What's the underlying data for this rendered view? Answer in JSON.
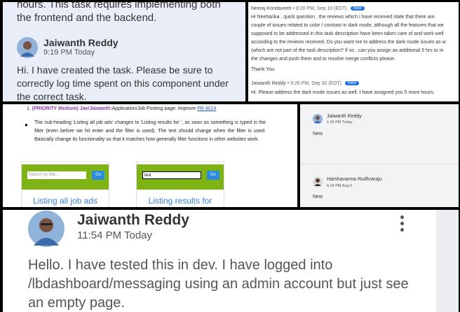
{
  "panel1": {
    "overflow_text": "hours. This task requires implementing both the frontend and the backend.",
    "author": "Jaiwanth Reddy",
    "time": "9:19 PM Today",
    "body": "Hi. I have created the task. Please be sure to correctly log time spent on this component under the correct task."
  },
  "panel2": {
    "comment1": {
      "author": "Neeraj Kondaveeti",
      "time": "• 8:20 PM, Sep 10 (EDT)",
      "badge": "New",
      "lines": [
        "Hi Neeharika , quick question , the reviews which i have received state that there are",
        "couple of issues related to color / contrast in dark mode, although all the features that we",
        "supposed to be addressed in this task description have been taken care of and work well",
        "according to the reviews received. Do you want me to address the dark mode issues as w",
        "(which are not part of the task description? If so , can you assign an additional 5 hrs to m",
        "the changes and push them and to resolve merge conflicts please."
      ],
      "thanks": "Thank You"
    },
    "comment2": {
      "author": "Jaiwanth Reddy",
      "time": "• 9:26 PM, Sep 30 (EDT)",
      "badge": "New",
      "body": "Hi. Please address the dark mode issues as well. I have assigned you 5 more hours."
    }
  },
  "panel3": {
    "number": "1.",
    "priority": "(PRIORITY Medium) Jae/Jaiwanth:",
    "title": "Application/Job Posting page: Improve",
    "link": "PR 4014",
    "bullet": "●",
    "paragraph": "The sub-heading 'Listing all job ads' changes to 'Listing results for ', as soon as something is typed in the filter (even before we hit enter and the filter is used). The text should change when the filter is used. Basically change its functionality so that it matches how generally filter functions in other websites work.",
    "mock1": {
      "placeholder": "Search by title...",
      "button": "Go",
      "caption": "Listing all job ads"
    },
    "mock2": {
      "value": "test",
      "button": "Go",
      "caption": "Listing results for"
    }
  },
  "panel4": {
    "msg1": {
      "author": "Jaiwanth Reddy",
      "time": "1:34 PM Today",
      "body": "New"
    },
    "msg2": {
      "author": "Harshavarma Rudhraraju",
      "time": "6:24 PM Aug 6",
      "body": "New"
    }
  },
  "panel5": {
    "author": "Jaiwanth Reddy",
    "time": "11:54 PM Today",
    "body": "Hello. I have tested this in dev. I have logged into /lbdashboard/messaging using an admin account but just see an empty page."
  },
  "colors": {
    "chat_bg": "#e8edf8",
    "badge_blue": "#1a73e8",
    "priority_purple": "#8e3aa8",
    "mock_green": "#7db413",
    "mock_button": "#2a8be0"
  }
}
